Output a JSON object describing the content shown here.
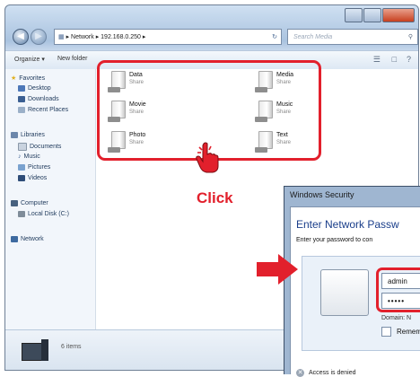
{
  "explorer": {
    "address_path": [
      "Network",
      "192.168.0.250"
    ],
    "search_placeholder": "Search Media",
    "toolbar": {
      "organize": "Organize ▾",
      "new_folder": "New folder"
    },
    "nav": {
      "favorites": "Favorites",
      "desktop": "Desktop",
      "downloads": "Downloads",
      "recent": "Recent Places",
      "libraries": "Libraries",
      "documents": "Documents",
      "music": "Music",
      "pictures": "Pictures",
      "videos": "Videos",
      "computer": "Computer",
      "local_disk": "Local Disk (C:)",
      "network": "Network"
    },
    "shares": [
      {
        "name": "Data",
        "type": "Share"
      },
      {
        "name": "Media",
        "type": "Share"
      },
      {
        "name": "Movie",
        "type": "Share"
      },
      {
        "name": "Music",
        "type": "Share"
      },
      {
        "name": "Photo",
        "type": "Share"
      },
      {
        "name": "Text",
        "type": "Share"
      }
    ],
    "status_count": "6 items"
  },
  "annotation": {
    "click_label": "Click",
    "accent": "#e2202c"
  },
  "dialog": {
    "title": "Windows Security",
    "heading": "Enter Network Passw",
    "subheading": "Enter your password to con",
    "username": "admin",
    "password_mask": "•••••",
    "domain_label": "Domain: N",
    "remember_label": "Remem",
    "access_msg": "Access is denied"
  }
}
